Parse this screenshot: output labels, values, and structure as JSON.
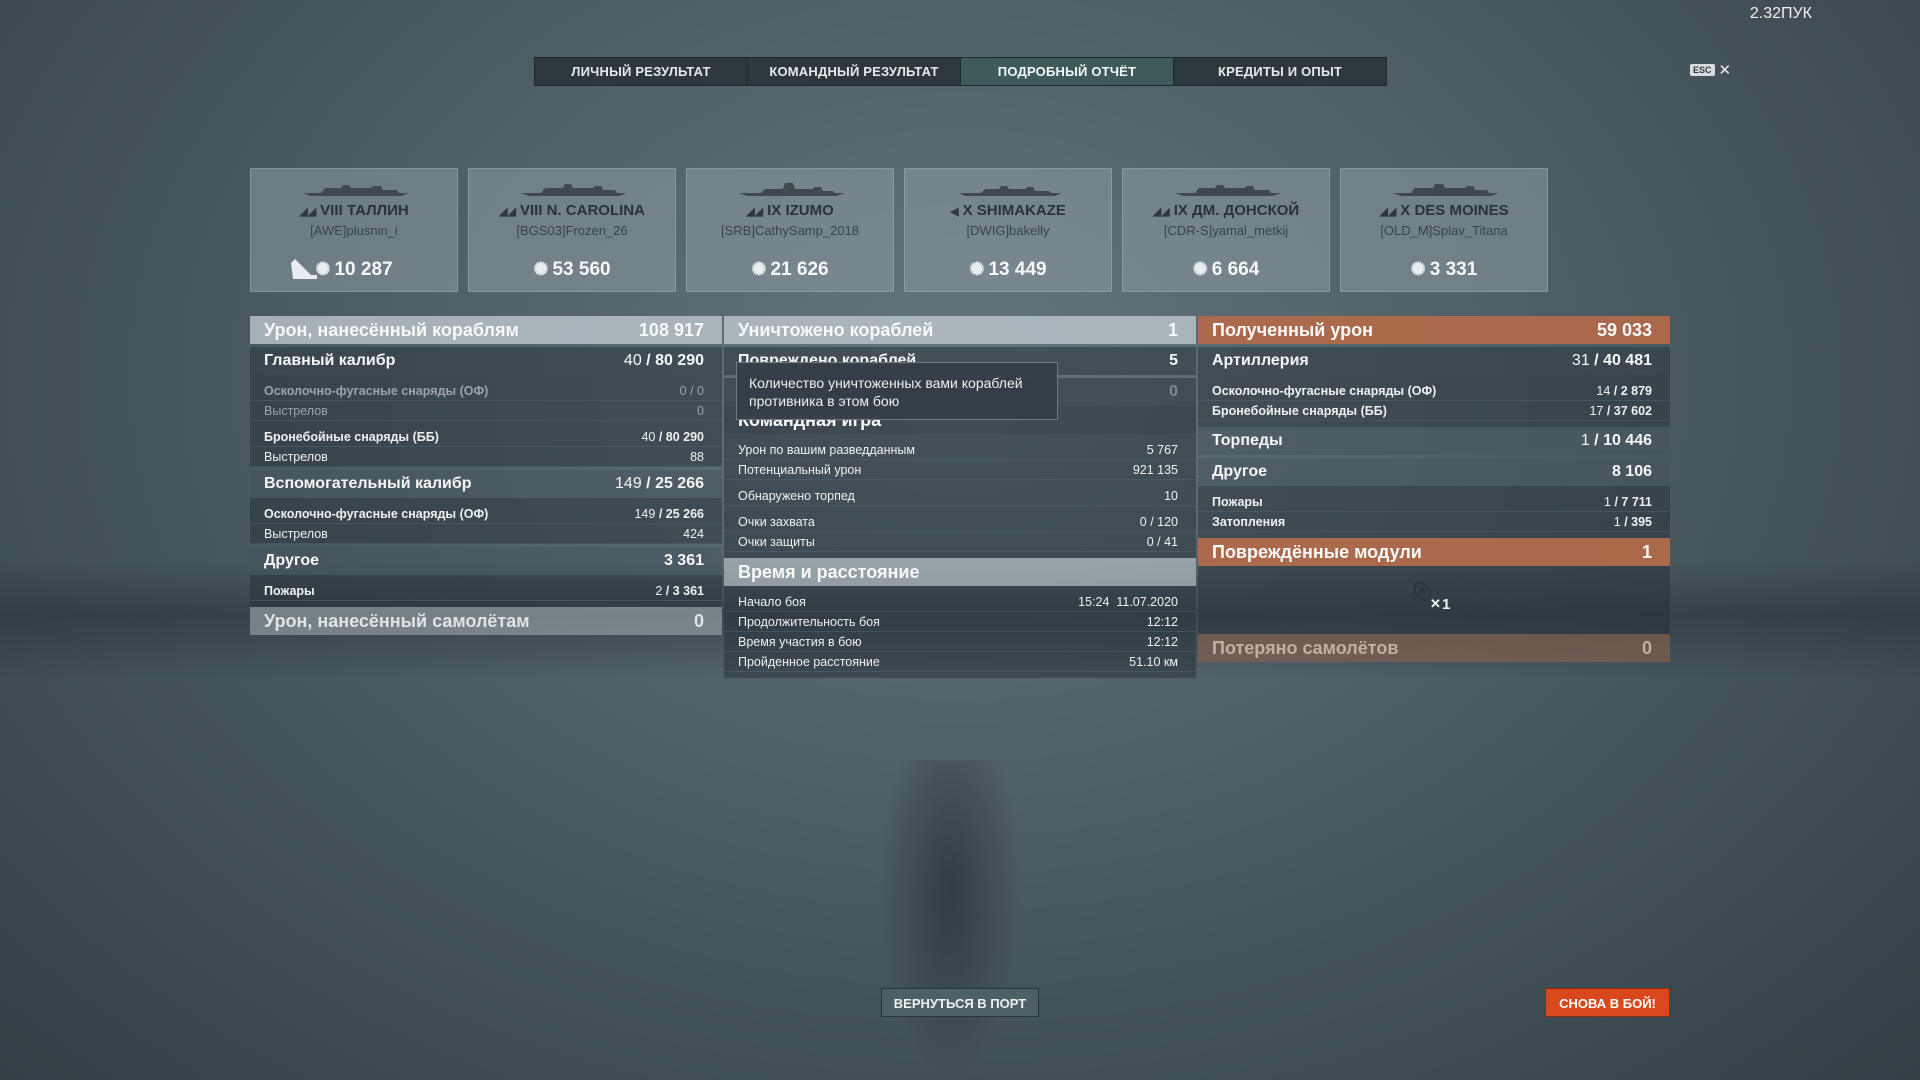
{
  "version": "2.32ПУК",
  "tabs": [
    {
      "label": "ЛИЧНЫЙ РЕЗУЛЬТАТ",
      "active": false
    },
    {
      "label": "КОМАНДНЫЙ РЕЗУЛЬТАТ",
      "active": false
    },
    {
      "label": "ПОДРОБНЫЙ ОТЧЁТ",
      "active": true
    },
    {
      "label": "КРЕДИТЫ И ОПЫТ",
      "active": false
    }
  ],
  "esc": {
    "key": "ESC",
    "close": "✕"
  },
  "cards": [
    {
      "ship": "VIII ТАЛЛИН",
      "player": "[AWE]plusnin_i",
      "damage": "10 287",
      "type_icon": "cruiser-icon",
      "killed": true
    },
    {
      "ship": "VIII N. CAROLINA",
      "player": "[BGS03]Frozen_26",
      "damage": "53 560",
      "type_icon": "battleship-icon",
      "killed": false
    },
    {
      "ship": "IX IZUMO",
      "player": "[SRB]CathySamp_2018",
      "damage": "21 626",
      "type_icon": "battleship-icon",
      "killed": false
    },
    {
      "ship": "X SHIMAKAZE",
      "player": "[DWIG]bakelly",
      "damage": "13 449",
      "type_icon": "destroyer-icon",
      "killed": false
    },
    {
      "ship": "IX ДМ. ДОНСКОЙ",
      "player": "[CDR-S]yamal_metkij",
      "damage": "6 664",
      "type_icon": "cruiser-icon",
      "killed": false
    },
    {
      "ship": "X DES MOINES",
      "player": "[OLD_M]Splav_Titana",
      "damage": "3 331",
      "type_icon": "cruiser-icon",
      "killed": false
    }
  ],
  "left": {
    "header": {
      "label": "Урон, нанесённый кораблям",
      "value": "108 917"
    },
    "main_caliber": {
      "label": "Главный калибр",
      "hits": "40",
      "value": "80 290"
    },
    "he": {
      "label": "Осколочно-фугасные снаряды (ОФ)",
      "value": "0 / 0"
    },
    "he_shots": {
      "label": "Выстрелов",
      "value": "0"
    },
    "ap": {
      "label": "Бронебойные снаряды (ББ)",
      "hits": "40",
      "value": "80 290"
    },
    "ap_shots": {
      "label": "Выстрелов",
      "value": "88"
    },
    "secondary": {
      "label": "Вспомогательный калибр",
      "hits": "149",
      "value": "25 266"
    },
    "sec_he": {
      "label": "Осколочно-фугасные снаряды (ОФ)",
      "hits": "149",
      "value": "25 266"
    },
    "sec_shots": {
      "label": "Выстрелов",
      "value": "424"
    },
    "other": {
      "label": "Другое",
      "value": "3 361"
    },
    "fires": {
      "label": "Пожары",
      "hits": "2",
      "value": "3 361"
    },
    "planes": {
      "label": "Урон, нанесённый самолётам",
      "value": "0"
    }
  },
  "middle": {
    "destroyed": {
      "label": "Уничтожено кораблей",
      "value": "1"
    },
    "damaged": {
      "label": "Повреждено кораблей",
      "value": "5"
    },
    "hidden": {
      "label": "",
      "value": "0"
    },
    "teamplay": {
      "label": "Командная игра"
    },
    "spotting": {
      "label": "Урон по вашим разведданным",
      "value": "5 767"
    },
    "potential": {
      "label": "Потенциальный урон",
      "value": "921 135"
    },
    "torpedoes": {
      "label": "Обнаружено торпед",
      "value": "10"
    },
    "capture": {
      "label": "Очки захвата",
      "value": "0 / 120"
    },
    "defense": {
      "label": "Очки защиты",
      "value": "0 / 41"
    },
    "time_header": {
      "label": "Время и расстояние"
    },
    "start": {
      "label": "Начало боя",
      "value": "15:24  11.07.2020"
    },
    "duration": {
      "label": "Продолжительность боя",
      "value": "12:12"
    },
    "participation": {
      "label": "Время участия в бою",
      "value": "12:12"
    },
    "distance": {
      "label": "Пройденное расстояние",
      "value": "51.10 км"
    },
    "tooltip": "Количество уничтоженных вами кораблей противника в этом бою"
  },
  "right": {
    "header": {
      "label": "Полученный урон",
      "value": "59 033"
    },
    "artillery": {
      "label": "Артиллерия",
      "hits": "31",
      "value": "40 481"
    },
    "he": {
      "label": "Осколочно-фугасные снаряды (ОФ)",
      "hits": "14",
      "value": "2 879"
    },
    "ap": {
      "label": "Бронебойные снаряды (ББ)",
      "hits": "17",
      "value": "37 602"
    },
    "torpedoes": {
      "label": "Торпеды",
      "hits": "1",
      "value": "10 446"
    },
    "other": {
      "label": "Другое",
      "value": "8 106"
    },
    "fires": {
      "label": "Пожары",
      "hits": "1",
      "value": "7 711"
    },
    "flooding": {
      "label": "Затопления",
      "hits": "1",
      "value": "395"
    },
    "modules": {
      "label": "Повреждённые модули",
      "value": "1",
      "count": "1"
    },
    "planes_lost": {
      "label": "Потеряно самолётов",
      "value": "0"
    }
  },
  "buttons": {
    "port": "ВЕРНУТЬСЯ В ПОРТ",
    "battle": "СНОВА В БОЙ!"
  }
}
